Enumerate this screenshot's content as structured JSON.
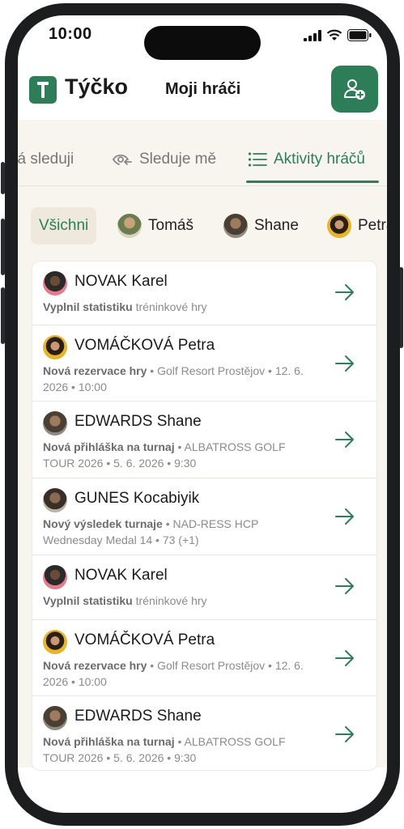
{
  "status": {
    "time": "10:00"
  },
  "appbar": {
    "logo_text": "Týčko",
    "title": "Moji hráči",
    "add_icon": "add-user-icon",
    "accent": "#2e7d59"
  },
  "tabs": [
    {
      "label": "Já sleduji",
      "icon": ""
    },
    {
      "label": "Sleduje mě",
      "icon": "eye-follow-icon"
    },
    {
      "label": "Aktivity hráčů",
      "icon": "list-icon",
      "active": true
    }
  ],
  "chips": [
    {
      "label": "Všichni",
      "active": true
    },
    {
      "label": "Tomáš"
    },
    {
      "label": "Shane"
    },
    {
      "label": "Petra"
    }
  ],
  "activities": [
    {
      "name": "NOVAK Karel",
      "action": "Vyplnil statistiku",
      "detail": " tréninkové hry"
    },
    {
      "name": "VOMÁČKOVÁ Petra",
      "action": "Nová rezervace hry",
      "detail": " • Golf Resort Prostějov • 12. 6. 2026 • 10:00"
    },
    {
      "name": "EDWARDS Shane",
      "action": "Nová přihláška na turnaj",
      "detail": " • ALBATROSS GOLF TOUR 2026 • 5. 6. 2026 • 9:30"
    },
    {
      "name": "GUNES Kocabiyik",
      "action": "Nový výsledek turnaje",
      "detail": " • NAD-RESS HCP Wednesday Medal 14 • 73 (+1)"
    },
    {
      "name": "NOVAK Karel",
      "action": "Vyplnil statistiku",
      "detail": " tréninkové hry"
    },
    {
      "name": "VOMÁČKOVÁ Petra",
      "action": "Nová rezervace hry",
      "detail": " • Golf Resort Prostějov • 12. 6. 2026 • 10:00"
    },
    {
      "name": "EDWARDS Shane",
      "action": "Nová přihláška na turnaj",
      "detail": " • ALBATROSS GOLF TOUR 2026 • 5. 6. 2026 • 9:30"
    }
  ]
}
